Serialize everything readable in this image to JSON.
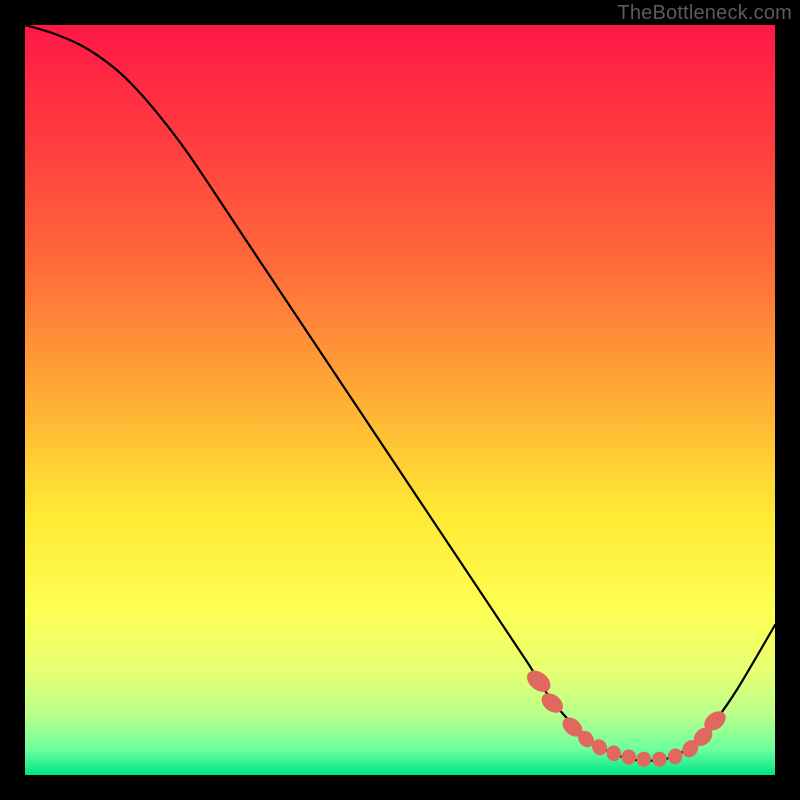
{
  "watermark": "TheBottleneck.com",
  "chart_data": {
    "type": "line",
    "title": "",
    "xlabel": "",
    "ylabel": "",
    "xlim": [
      0,
      100
    ],
    "ylim": [
      0,
      100
    ],
    "gradient_stops": [
      {
        "offset": 0.0,
        "color": "#ff1846"
      },
      {
        "offset": 0.15,
        "color": "#ff3b3f"
      },
      {
        "offset": 0.32,
        "color": "#ff6a3a"
      },
      {
        "offset": 0.5,
        "color": "#ffae35"
      },
      {
        "offset": 0.65,
        "color": "#ffe933"
      },
      {
        "offset": 0.78,
        "color": "#fdff53"
      },
      {
        "offset": 0.86,
        "color": "#e8ff72"
      },
      {
        "offset": 0.92,
        "color": "#b8ff8a"
      },
      {
        "offset": 0.965,
        "color": "#6fff9e"
      },
      {
        "offset": 1.0,
        "color": "#00e588"
      }
    ],
    "series": [
      {
        "name": "bottleneck-curve",
        "x": [
          0.0,
          4.0,
          8.0,
          12.0,
          15.0,
          18.0,
          22.0,
          30.0,
          40.0,
          50.0,
          58.0,
          63.0,
          67.0,
          70.0,
          73.5,
          77.0,
          80.0,
          83.0,
          86.0,
          89.0,
          92.0,
          95.0,
          100.0
        ],
        "y": [
          100.0,
          98.8,
          97.0,
          94.2,
          91.3,
          87.8,
          82.5,
          70.5,
          55.5,
          40.5,
          28.5,
          21.0,
          15.0,
          10.3,
          6.3,
          3.6,
          2.3,
          1.9,
          2.3,
          4.0,
          7.2,
          11.5,
          20.0
        ]
      }
    ],
    "markers": {
      "name": "highlight-dots",
      "color": "#e0685e",
      "points": [
        {
          "x": 68.5,
          "y": 12.5,
          "rx": 2.8,
          "ry": 4.2,
          "rot": -52
        },
        {
          "x": 70.3,
          "y": 9.6,
          "rx": 2.6,
          "ry": 3.8,
          "rot": -52
        },
        {
          "x": 73.0,
          "y": 6.4,
          "rx": 2.5,
          "ry": 3.6,
          "rot": -48
        },
        {
          "x": 74.8,
          "y": 4.8,
          "rx": 2.3,
          "ry": 2.8,
          "rot": -40
        },
        {
          "x": 76.6,
          "y": 3.7,
          "rx": 2.3,
          "ry": 2.6,
          "rot": -25
        },
        {
          "x": 78.5,
          "y": 2.9,
          "rx": 2.3,
          "ry": 2.5,
          "rot": -10
        },
        {
          "x": 80.5,
          "y": 2.4,
          "rx": 2.3,
          "ry": 2.4,
          "rot": 0
        },
        {
          "x": 82.5,
          "y": 2.1,
          "rx": 2.3,
          "ry": 2.4,
          "rot": 0
        },
        {
          "x": 84.6,
          "y": 2.1,
          "rx": 2.3,
          "ry": 2.4,
          "rot": 0
        },
        {
          "x": 86.7,
          "y": 2.5,
          "rx": 2.3,
          "ry": 2.5,
          "rot": 15
        },
        {
          "x": 88.7,
          "y": 3.5,
          "rx": 2.4,
          "ry": 2.9,
          "rot": 35
        },
        {
          "x": 90.4,
          "y": 5.1,
          "rx": 2.5,
          "ry": 3.3,
          "rot": 46
        },
        {
          "x": 92.0,
          "y": 7.2,
          "rx": 2.6,
          "ry": 3.8,
          "rot": 52
        }
      ]
    }
  }
}
